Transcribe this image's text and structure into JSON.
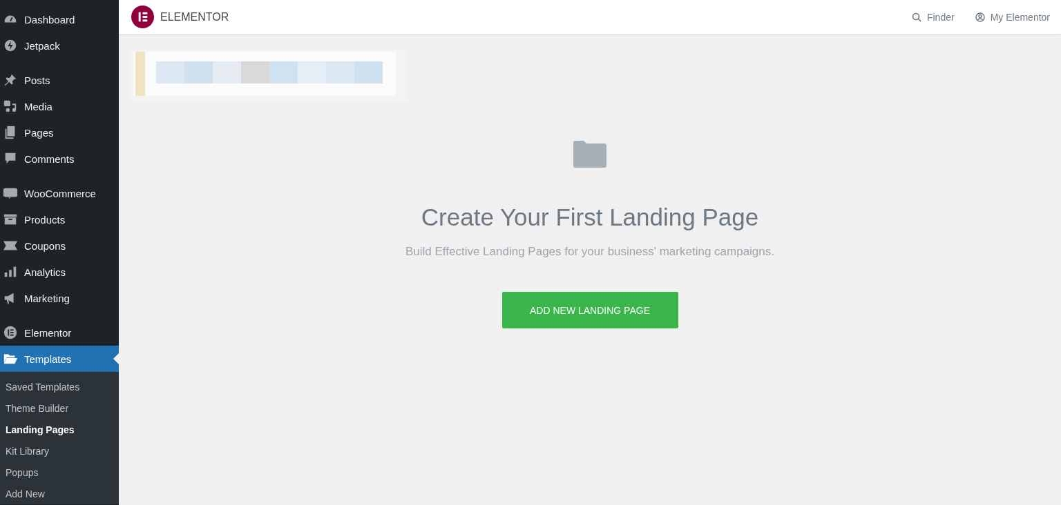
{
  "sidebar": {
    "groups": [
      {
        "items": [
          {
            "label": "Dashboard",
            "selected": false
          },
          {
            "label": "Jetpack",
            "selected": false
          }
        ]
      },
      {
        "items": [
          {
            "label": "Posts",
            "selected": false
          },
          {
            "label": "Media",
            "selected": false
          },
          {
            "label": "Pages",
            "selected": false
          },
          {
            "label": "Comments",
            "selected": false
          }
        ]
      },
      {
        "items": [
          {
            "label": "WooCommerce",
            "selected": false
          },
          {
            "label": "Products",
            "selected": false
          },
          {
            "label": "Coupons",
            "selected": false
          },
          {
            "label": "Analytics",
            "selected": false
          },
          {
            "label": "Marketing",
            "selected": false
          }
        ]
      },
      {
        "items": [
          {
            "label": "Elementor",
            "selected": false
          },
          {
            "label": "Templates",
            "selected": true,
            "children": [
              {
                "label": "Saved Templates",
                "selected": false
              },
              {
                "label": "Theme Builder",
                "selected": false
              },
              {
                "label": "Landing Pages",
                "selected": true
              },
              {
                "label": "Kit Library",
                "selected": false
              },
              {
                "label": "Popups",
                "selected": false
              },
              {
                "label": "Add New",
                "selected": false
              }
            ]
          }
        ]
      }
    ]
  },
  "header": {
    "brand": "ELEMENTOR",
    "links": [
      "Finder",
      "My Elementor"
    ]
  },
  "empty_state": {
    "title": "Create Your First Landing Page",
    "subtitle": "Build Effective Landing Pages for your business' marketing campaigns.",
    "button": "ADD NEW LANDING PAGE"
  }
}
